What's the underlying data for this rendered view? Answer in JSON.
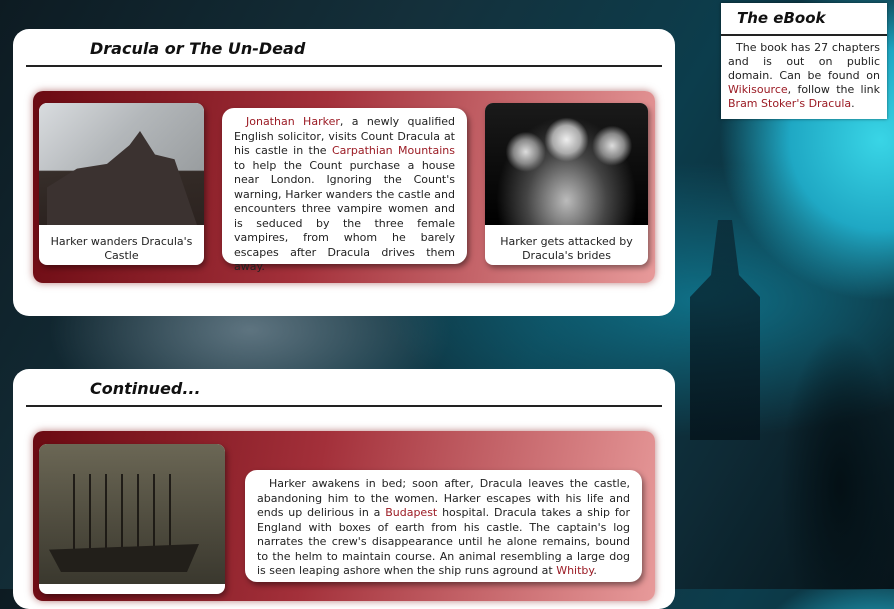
{
  "colors": {
    "accent_link": "#9b1b24",
    "panel_dark": "#6b0a12",
    "panel_light": "#e79a9a",
    "moon": "#39d5e6"
  },
  "section1": {
    "title": "Dracula or The Un-Dead",
    "left_image": {
      "icon": "castle-photo",
      "caption": "Harker wanders Dracula's Castle"
    },
    "right_image": {
      "icon": "brides-photo",
      "caption": "Harker gets attacked by Dracula's brides"
    },
    "text": {
      "link1": "Jonathan Harker",
      "part1": ", a newly qualified English solicitor, visits Count Dracula at his castle in the ",
      "link2": "Carpathian Mountains",
      "part2": " to help the Count purchase a house near London. Ignoring the Count's warning, Harker wanders the castle and encounters three vampire women and is seduced by the three female vampires, from whom he barely escapes after Dracula drives them away."
    }
  },
  "section2": {
    "title": "Continued...",
    "left_image": {
      "icon": "ship-photo"
    },
    "text": {
      "part1": "Harker awakens in bed; soon after, Dracula leaves the castle, abandoning him to the women. Harker escapes with his life and ends up delirious in a ",
      "link1": "Budapest",
      "part2": " hospital. Dracula takes a ship for England with boxes of earth from his castle. The captain's log narrates the crew's disappearance until he alone remains, bound to the helm to maintain course. An animal resembling a large dog is seen leaping ashore when the ship runs aground at ",
      "link2": "Whitby",
      "part3": "."
    }
  },
  "ebook": {
    "title": "The eBook",
    "part1": "The book has 27 chapters and is out on public domain. Can be found on ",
    "link1": "Wikisource",
    "part2": ", follow the link ",
    "link2": "Bram Stoker's Dracula",
    "part3": "."
  }
}
